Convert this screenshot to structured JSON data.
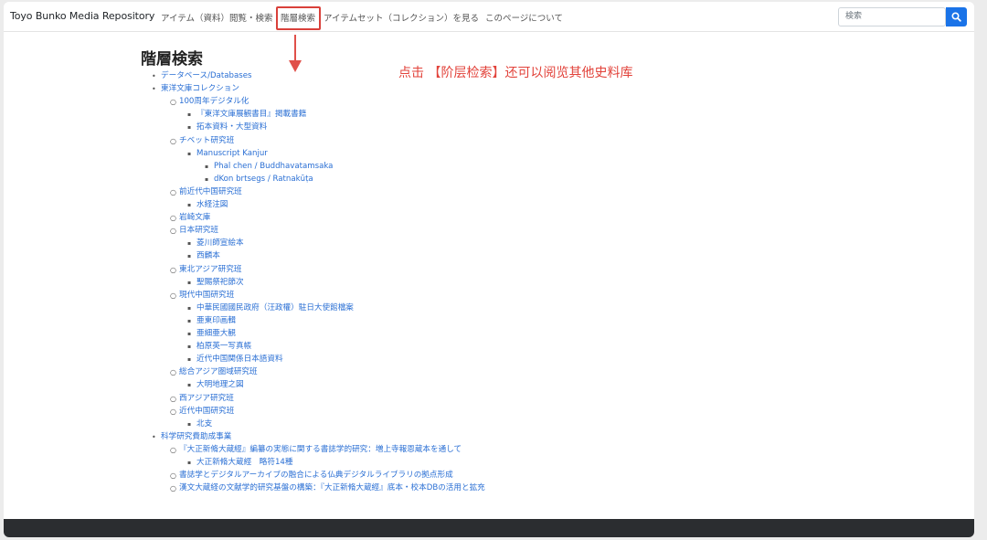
{
  "nav": {
    "brand": "Toyo Bunko Media Repository",
    "items": [
      "アイテム（資料）閲覧・検索",
      "階層検索",
      "アイテムセット（コレクション）を見る",
      "このページについて"
    ],
    "search_placeholder": "検索",
    "search_icon": "search-icon"
  },
  "page_title": "階層検索",
  "annotation": "点击 【阶层检索】还可以阅览其他史料库",
  "tree": [
    "データベース/Databases",
    "東洋文庫コレクション",
    "100周年デジタル化",
    "『東洋文庫展観書目』掲載書籍",
    "拓本資料・大型資料",
    "チベット研究班",
    "Manuscript Kanjur",
    "Phal chen / Buddhavatamsaka",
    "dKon brtsegs / Ratnakūṭa",
    "前近代中国研究班",
    "水経注図",
    "岩崎文庫",
    "日本研究班",
    "菱川師宣絵本",
    "西麟本",
    "東北アジア研究班",
    "聖賜祭祀節次",
    "現代中国研究班",
    "中華民國國民政府（汪政權）駐日大使館檔案",
    "亜東印画輯",
    "亜細亜大観",
    "柏原英一写真帳",
    "近代中国関係日本語資料",
    "総合アジア圏域研究班",
    "大明地理之図",
    "西アジア研究班",
    "近代中国研究班",
    "北支",
    "科学研究費助成事業",
    "『大正新脩大蔵經』編纂の実態に関する書誌学的研究：増上寺報恩蔵本を通して",
    "大正新脩大蔵經　略符14種",
    "書誌学とデジタルアーカイブの融合による仏典デジタルライブラリの拠点形成",
    "漢文大蔵経の文献学的研究基盤の構築：『大正新脩大蔵經』底本・校本DBの活用と拡充"
  ],
  "colors": {
    "link": "#2a6fd4",
    "highlight": "#d9403a",
    "accent": "#1a73e8",
    "footer": "#2b2d30"
  }
}
